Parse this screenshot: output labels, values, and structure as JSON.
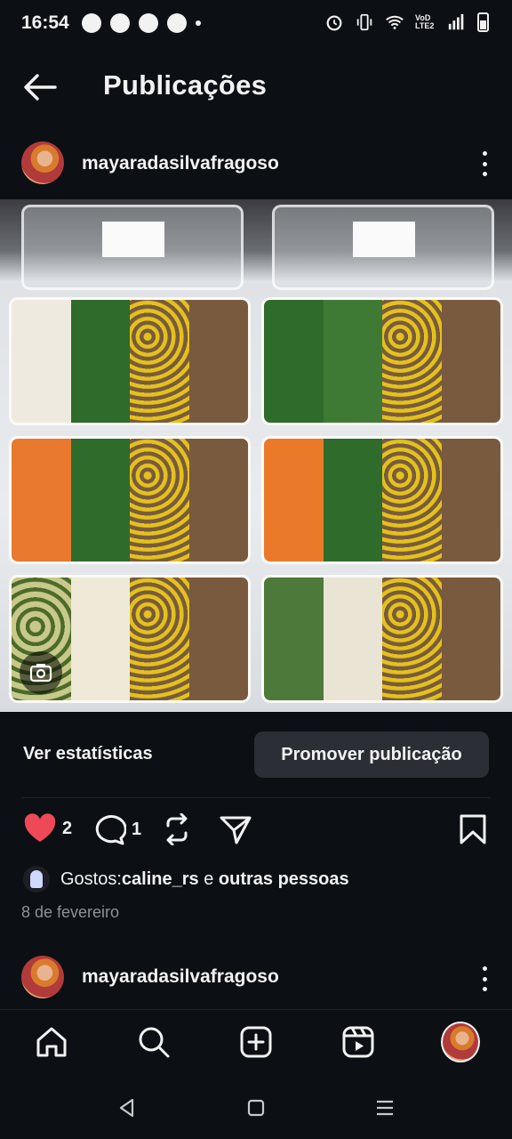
{
  "status_bar": {
    "time": "16:54",
    "network_label": "VoD LTE2",
    "icons": [
      "messenger-icon",
      "message-icon",
      "messenger-icon",
      "alarm-icon",
      "vibrate-icon",
      "wifi-icon",
      "signal-icon",
      "battery-icon"
    ]
  },
  "header": {
    "title": "Publicações",
    "back_icon": "arrow-left-icon"
  },
  "post": {
    "username": "mayaradasilvafragoso",
    "image_alt": "marmitas",
    "stats_link": "Ver estatísticas",
    "promote_button": "Promover publicação",
    "likes_count": "2",
    "comments_count": "1",
    "likes_prefix": "Gostos: ",
    "likes_user": "caline_rs",
    "likes_conjunction": " e ",
    "likes_others": "outras pessoas",
    "date": "8 de fevereiro",
    "accent_like_color": "#ed4956"
  },
  "next_post": {
    "username": "mayaradasilvafragoso"
  },
  "bottom_nav": {
    "items": [
      "home-icon",
      "search-icon",
      "create-icon",
      "reels-icon",
      "profile-avatar"
    ]
  },
  "system_nav": {
    "items": [
      "back-triangle-icon",
      "home-square-icon",
      "recents-icon"
    ]
  }
}
